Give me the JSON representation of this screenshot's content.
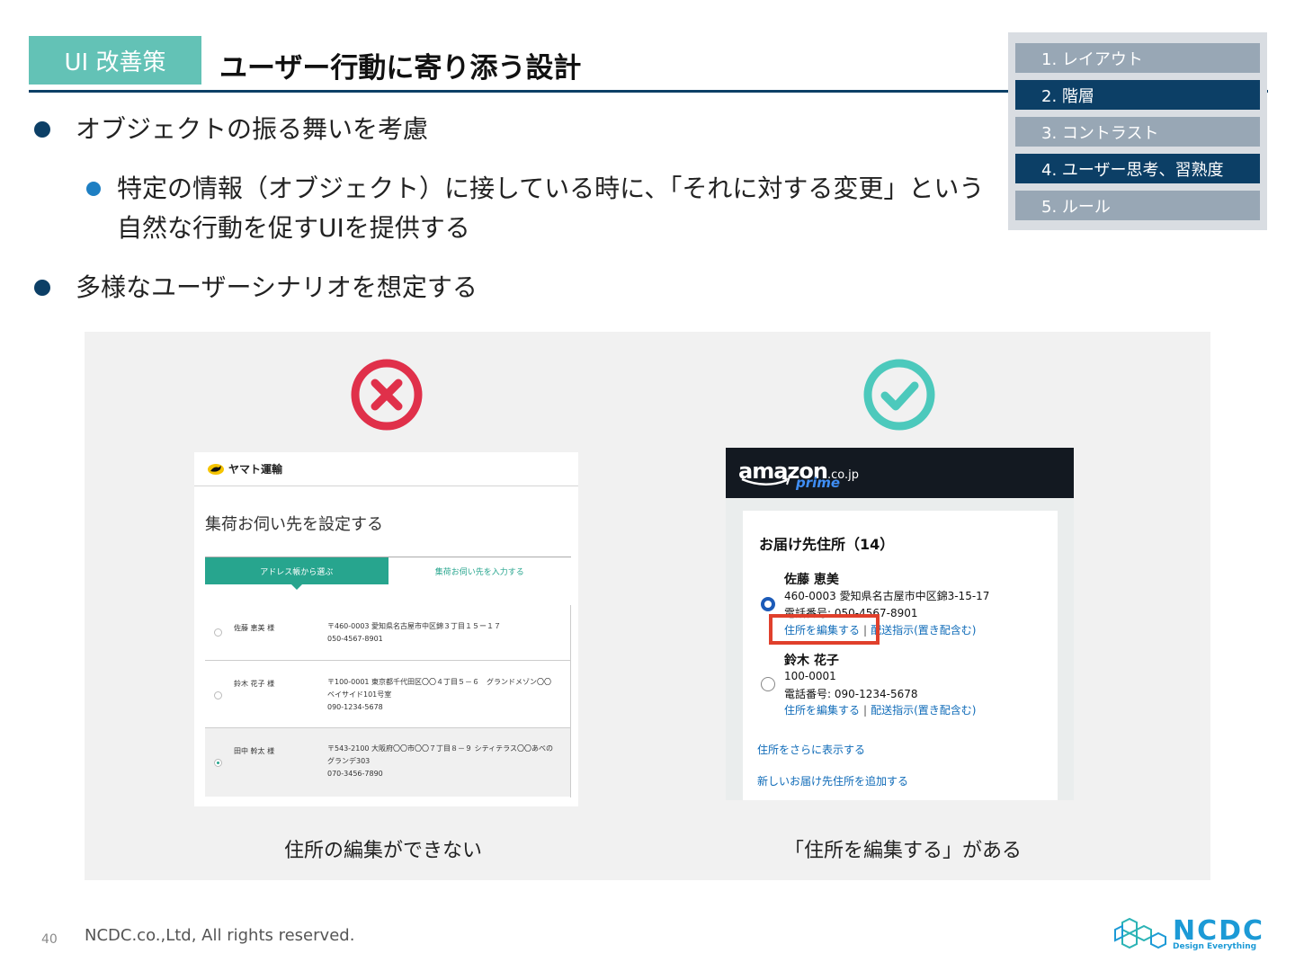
{
  "header": {
    "tag": "UI 改善策",
    "title": "ユーザー行動に寄り添う設計"
  },
  "nav": {
    "items": [
      {
        "label": "1. レイアウト",
        "active": false
      },
      {
        "label": "2. 階層",
        "active": true
      },
      {
        "label": "3. コントラスト",
        "active": false
      },
      {
        "label": "4. ユーザー思考、習熟度",
        "active": true
      },
      {
        "label": "5. ルール",
        "active": false
      }
    ]
  },
  "bullets": {
    "b1": "オブジェクトの振る舞いを考慮",
    "b2": "特定の情報（オブジェクト）に接している時に、「それに対する変更」という自然な行動を促すUIを提供する",
    "b3": "多様なユーザーシナリオを想定する"
  },
  "yamato": {
    "brand": "ヤマト運輸",
    "title": "集荷お伺い先を設定する",
    "tab_active": "アドレス帳から選ぶ",
    "tab_other": "集荷お伺い先を入力する",
    "rows": [
      {
        "name": "佐藤 恵美 様",
        "addr1": "〒460-0003 愛知県名古屋市中区錦３丁目１５ー１７",
        "addr2": "050-4567-8901",
        "addr3": ""
      },
      {
        "name": "鈴木 花子 様",
        "addr1": "〒100-0001 東京都千代田区〇〇４丁目５－６　グランドメゾン〇〇",
        "addr2": "ベイサイド101号室",
        "addr3": "090-1234-5678"
      },
      {
        "name": "田中 幹太 様",
        "addr1": "〒543-2100 大阪府〇〇市〇〇７丁目８－９ シティテラス〇〇あべの",
        "addr2": "グランデ303",
        "addr3": "070-3456-7890"
      }
    ],
    "caption": "住所の編集ができない"
  },
  "amazon": {
    "logo": "amazon",
    "domain": ".co.jp",
    "prime": "prime",
    "heading": "お届け先住所（14）",
    "entries": [
      {
        "name": "佐藤 恵美",
        "line1": "460-0003 愛知県名古屋市中区錦3-15-17",
        "line2": "電話番号: 050-4567-8901",
        "edit": "住所を編集する",
        "sep": "|",
        "delivery": "配送指示(置き配含む)"
      },
      {
        "name": "鈴木 花子",
        "line1": "100-0001",
        "line2": "電話番号: 090-1234-5678",
        "edit": "住所を編集する",
        "sep": "|",
        "delivery": "配送指示(置き配含む)"
      }
    ],
    "more": "住所をさらに表示する",
    "add": "新しいお届け先住所を追加する",
    "caption": "「住所を編集する」がある"
  },
  "footer": {
    "page": "40",
    "copyright": "NCDC.co.,Ltd, All rights reserved.",
    "logo": "NCDC",
    "logo_sub": "Design Everything"
  },
  "colors": {
    "accent": "#63c2b6",
    "navy": "#0c3f66",
    "bad": "#e0304a",
    "good": "#4cc9bc",
    "highlight": "#e0402c"
  }
}
